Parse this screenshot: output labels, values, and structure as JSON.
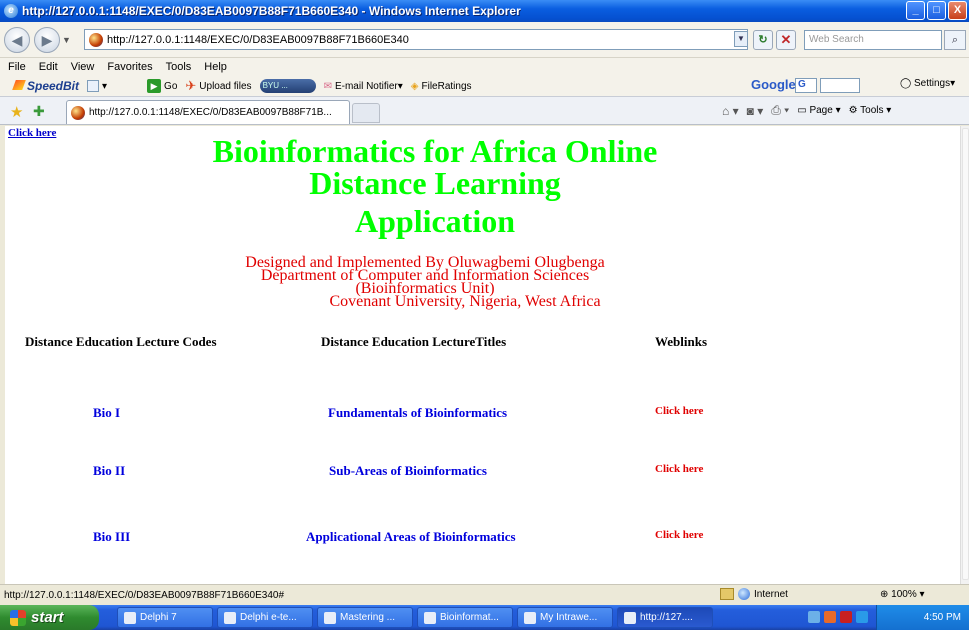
{
  "window": {
    "title": "http://127.0.0.1:1148/EXEC/0/D83EAB0097B88F71B660E340 - Windows Internet Explorer",
    "controls": {
      "minimize": "_",
      "maximize": "□",
      "close": "X"
    }
  },
  "addressbar": {
    "url": "http://127.0.0.1:1148/EXEC/0/D83EAB0097B88F71B660E340",
    "search_placeholder": "Web Search"
  },
  "menu": [
    "File",
    "Edit",
    "View",
    "Favorites",
    "Tools",
    "Help"
  ],
  "toolbar": {
    "speedbit": "SpeedBit",
    "go": "Go",
    "upload": "Upload files",
    "byu": "BYU ...",
    "email_notifier": "E-mail Notifier",
    "fileratings": "FileRatings",
    "google": "Google",
    "google_g": "G",
    "settings": "Settings"
  },
  "tab": {
    "title": "http://127.0.0.1:1148/EXEC/0/D83EAB0097B88F71B...",
    "page": "Page",
    "tools": "Tools"
  },
  "page": {
    "top_link": "Click here",
    "heading_line1": "Bioinformatics for Africa Online",
    "heading_line2": "Distance Learning",
    "heading_line3": "Application",
    "credits": [
      "Designed and Implemented By Oluwagbemi Olugbenga",
      "Department of Computer and Information Sciences",
      "(Bioinformatics Unit)",
      "Covenant University, Nigeria, West Africa"
    ],
    "columns": {
      "codes": "Distance Education Lecture Codes",
      "titles": "Distance Education LectureTitles",
      "weblinks": "Weblinks"
    },
    "lectures": [
      {
        "code": "Bio I",
        "title": "Fundamentals of Bioinformatics",
        "link": "Click here"
      },
      {
        "code": "Bio II",
        "title": "Sub-Areas of Bioinformatics",
        "link": "Click here"
      },
      {
        "code": "Bio III",
        "title": "Applicational Areas of Bioinformatics",
        "link": "Click here"
      }
    ]
  },
  "statusbar": {
    "url": "http://127.0.0.1:1148/EXEC/0/D83EAB0097B88F71B660E340#",
    "zone": "Internet",
    "zoom": "100%"
  },
  "taskbar": {
    "start": "start",
    "buttons": [
      "Delphi 7",
      "Delphi e-te...",
      "Mastering ...",
      "Bioinformat...",
      "My Intrawe...",
      "http://127...."
    ],
    "clock": "4:50 PM"
  }
}
